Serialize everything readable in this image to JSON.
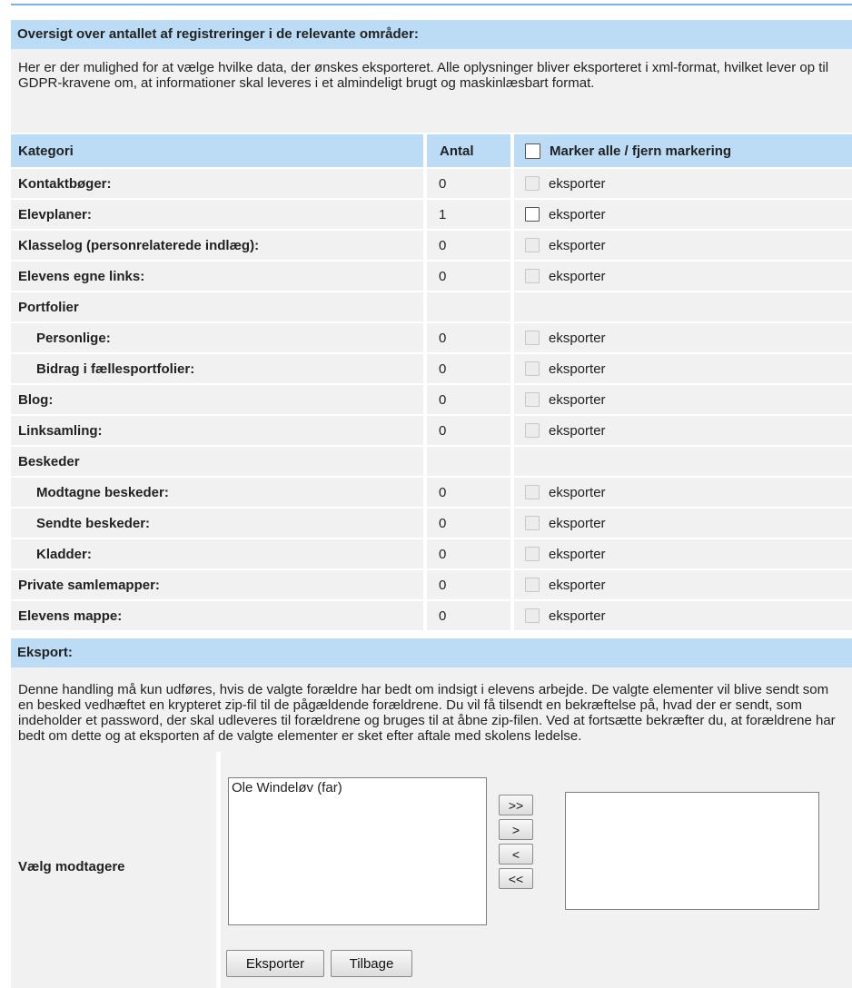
{
  "overview": {
    "title": "Oversigt over antallet af registreringer i de relevante områder:",
    "description": "Her er der mulighed for at vælge hvilke data, der ønskes eksporteret. Alle oplysninger bliver eksporteret i xml-format, hvilket lever op til GDPR-kravene om, at informationer skal leveres i et almindeligt brugt og maskinlæsbart format."
  },
  "table": {
    "headers": {
      "category": "Kategori",
      "count": "Antal",
      "select_all": "Marker alle / fjern markering"
    },
    "export_label": "eksporter",
    "rows": [
      {
        "label": "Kontaktbøger:",
        "count": "0",
        "enabled": false
      },
      {
        "label": "Elevplaner:",
        "count": "1",
        "enabled": true
      },
      {
        "label": "Klasselog (personrelaterede indlæg):",
        "count": "0",
        "enabled": false
      },
      {
        "label": "Elevens egne links:",
        "count": "0",
        "enabled": false
      },
      {
        "label": "Portfolier",
        "count": "",
        "group": true
      },
      {
        "label": "Personlige:",
        "count": "0",
        "enabled": false,
        "sub": true
      },
      {
        "label": "Bidrag i fællesportfolier:",
        "count": "0",
        "enabled": false,
        "sub": true
      },
      {
        "label": "Blog:",
        "count": "0",
        "enabled": false
      },
      {
        "label": "Linksamling:",
        "count": "0",
        "enabled": false
      },
      {
        "label": "Beskeder",
        "count": "",
        "group": true
      },
      {
        "label": "Modtagne beskeder:",
        "count": "0",
        "enabled": false,
        "sub": true
      },
      {
        "label": "Sendte beskeder:",
        "count": "0",
        "enabled": false,
        "sub": true
      },
      {
        "label": "Kladder:",
        "count": "0",
        "enabled": false,
        "sub": true
      },
      {
        "label": "Private samlemapper:",
        "count": "0",
        "enabled": false
      },
      {
        "label": "Elevens mappe:",
        "count": "0",
        "enabled": false
      }
    ]
  },
  "export": {
    "title": "Eksport:",
    "description": "Denne handling må kun udføres, hvis de valgte forældre har bedt om indsigt i elevens arbejde. De valgte elementer vil blive sendt som en besked vedhæftet en krypteret zip-fil til de pågældende forældrene. Du vil få tilsendt en bekræftelse på, hvad der er sendt, som indeholder et password, der skal udleveres til forældrene og bruges til at åbne zip-filen. Ved at fortsætte bekræfter du, at forældrene har bedt om dette og at eksporten af de valgte elementer er sket efter aftale med skolens ledelse."
  },
  "recipients": {
    "label": "Vælg modtagere",
    "available": [
      "Ole Windeløv (far)"
    ],
    "selected": [],
    "buttons": {
      "add_all": ">>",
      "add": ">",
      "remove": "<",
      "remove_all": "<<"
    }
  },
  "actions": {
    "export": "Eksporter",
    "back": "Tilbage"
  }
}
